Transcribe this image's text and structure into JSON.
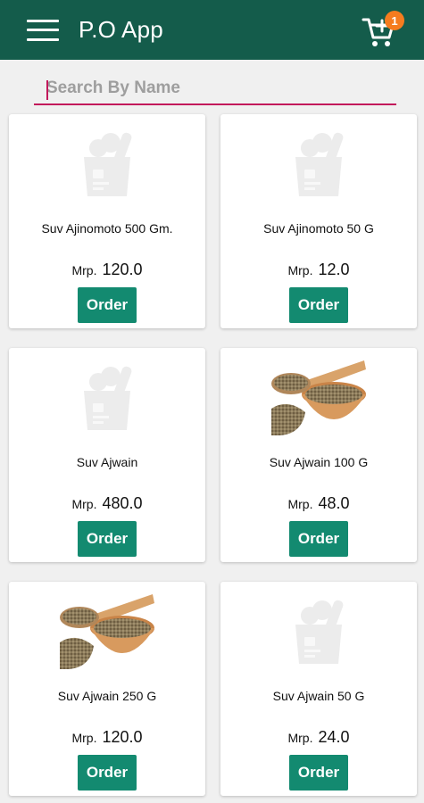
{
  "appbar": {
    "title": "P.O App",
    "cart_badge": "1",
    "bg_color": "#145c4b",
    "menu_icon": "hamburger-menu-icon",
    "cart_icon": "add-to-cart-icon"
  },
  "search": {
    "placeholder": "Search By Name",
    "value": "",
    "underline_color": "#c2185b"
  },
  "products": [
    {
      "name": "Suv Ajinomoto 500 Gm.",
      "mrp_label": "Mrp.",
      "price": "120.0",
      "image": "grocery-bag-placeholder-icon",
      "order_label": "Order"
    },
    {
      "name": "Suv Ajinomoto 50 G",
      "mrp_label": "Mrp.",
      "price": "12.0",
      "image": "grocery-bag-placeholder-icon",
      "order_label": "Order"
    },
    {
      "name": "Suv Ajwain",
      "mrp_label": "Mrp.",
      "price": "480.0",
      "image": "grocery-bag-placeholder-icon",
      "order_label": "Order"
    },
    {
      "name": "Suv Ajwain 100 G",
      "mrp_label": "Mrp.",
      "price": "48.0",
      "image": "ajwain-seeds-photo",
      "order_label": "Order"
    },
    {
      "name": "Suv Ajwain 250 G",
      "mrp_label": "Mrp.",
      "price": "120.0",
      "image": "ajwain-seeds-photo",
      "order_label": "Order"
    },
    {
      "name": "Suv Ajwain 50 G",
      "mrp_label": "Mrp.",
      "price": "24.0",
      "image": "grocery-bag-placeholder-icon",
      "order_label": "Order"
    }
  ],
  "colors": {
    "order_button": "#138a70",
    "badge": "#f57c1f"
  }
}
